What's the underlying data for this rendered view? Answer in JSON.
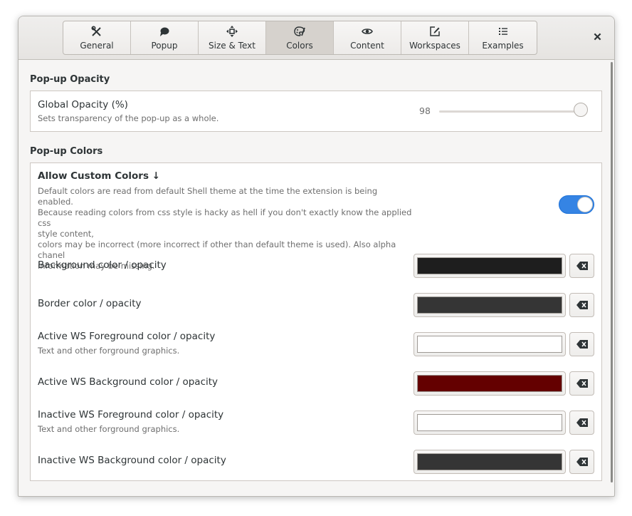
{
  "tabs": [
    {
      "label": "General",
      "icon": "tools-icon"
    },
    {
      "label": "Popup",
      "icon": "speech-bubble-icon"
    },
    {
      "label": "Size & Text",
      "icon": "move-arrows-icon"
    },
    {
      "label": "Colors",
      "icon": "palette-icon",
      "active": true
    },
    {
      "label": "Content",
      "icon": "eye-icon"
    },
    {
      "label": "Workspaces",
      "icon": "edit-icon"
    },
    {
      "label": "Examples",
      "icon": "list-icon"
    }
  ],
  "opacity_section": {
    "title": "Pop-up Opacity",
    "row_title": "Global Opacity (%)",
    "row_subtitle": "Sets transparency of the pop-up as a whole.",
    "value": "98",
    "slider_fraction": 0.98
  },
  "colors_section": {
    "title": "Pop-up Colors",
    "allow": {
      "title": "Allow Custom Colors ↓",
      "description_lines": [
        "Default colors are read from default Shell theme at the time the extension is being enabled.",
        "Because reading colors from css style is hacky as hell if you don't exactly know the applied css",
        "style content,",
        "colors may be incorrect (more incorrect if other than default theme is used). Also alpha chanel",
        "information may be missing."
      ],
      "enabled": true,
      "toggle_color": "#3584e4"
    },
    "rows": [
      {
        "label": "Background color / opacity",
        "subtitle": "",
        "color": "#1e1e1e"
      },
      {
        "label": "Border color / opacity",
        "subtitle": "",
        "color": "#353535"
      },
      {
        "label": "Active WS Foreground color / opacity",
        "subtitle": "Text and other forground graphics.",
        "color": "#ffffff"
      },
      {
        "label": "Active WS Background color  / opacity",
        "subtitle": "",
        "color": "#640000"
      },
      {
        "label": "Inactive WS Foreground color / opacity",
        "subtitle": "Text and other forground graphics.",
        "color": "#ffffff"
      },
      {
        "label": "Inactive WS Background color  / opacity",
        "subtitle": "",
        "color": "#353535"
      }
    ]
  }
}
